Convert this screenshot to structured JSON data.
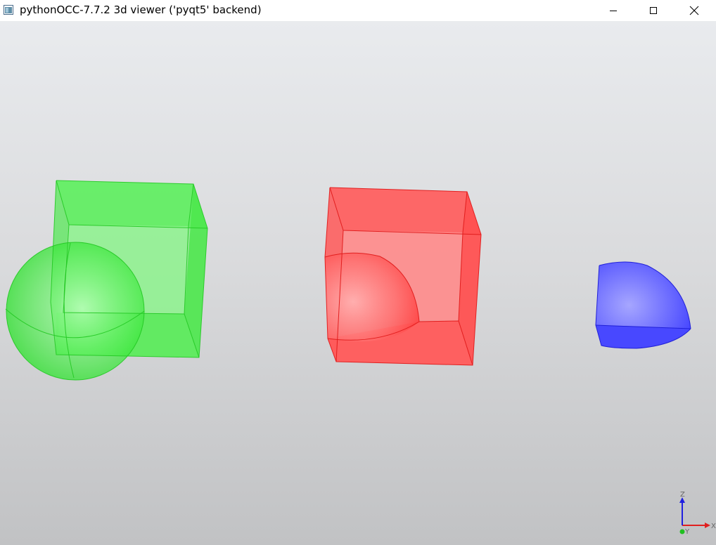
{
  "window": {
    "title": "pythonOCC-7.7.2 3d viewer ('pyqt5' backend)",
    "icon": "app-window-icon",
    "controls": {
      "minimize_icon": "minimize-icon",
      "maximize_icon": "maximize-icon",
      "close_icon": "close-icon"
    }
  },
  "viewport": {
    "background_top": "#e9ebee",
    "background_bottom": "#c1c2c4",
    "shapes": [
      {
        "name": "green-box-with-sphere",
        "color": "#33ee33"
      },
      {
        "name": "red-box-with-sphere-cut",
        "color": "#ff3333"
      },
      {
        "name": "blue-sphere-quarter",
        "color": "#3333ff"
      }
    ],
    "trihedron": {
      "x_label": "X",
      "y_label": "Y",
      "z_label": "Z",
      "x_color": "#e02020",
      "y_color": "#20c020",
      "z_color": "#2020e0"
    }
  }
}
